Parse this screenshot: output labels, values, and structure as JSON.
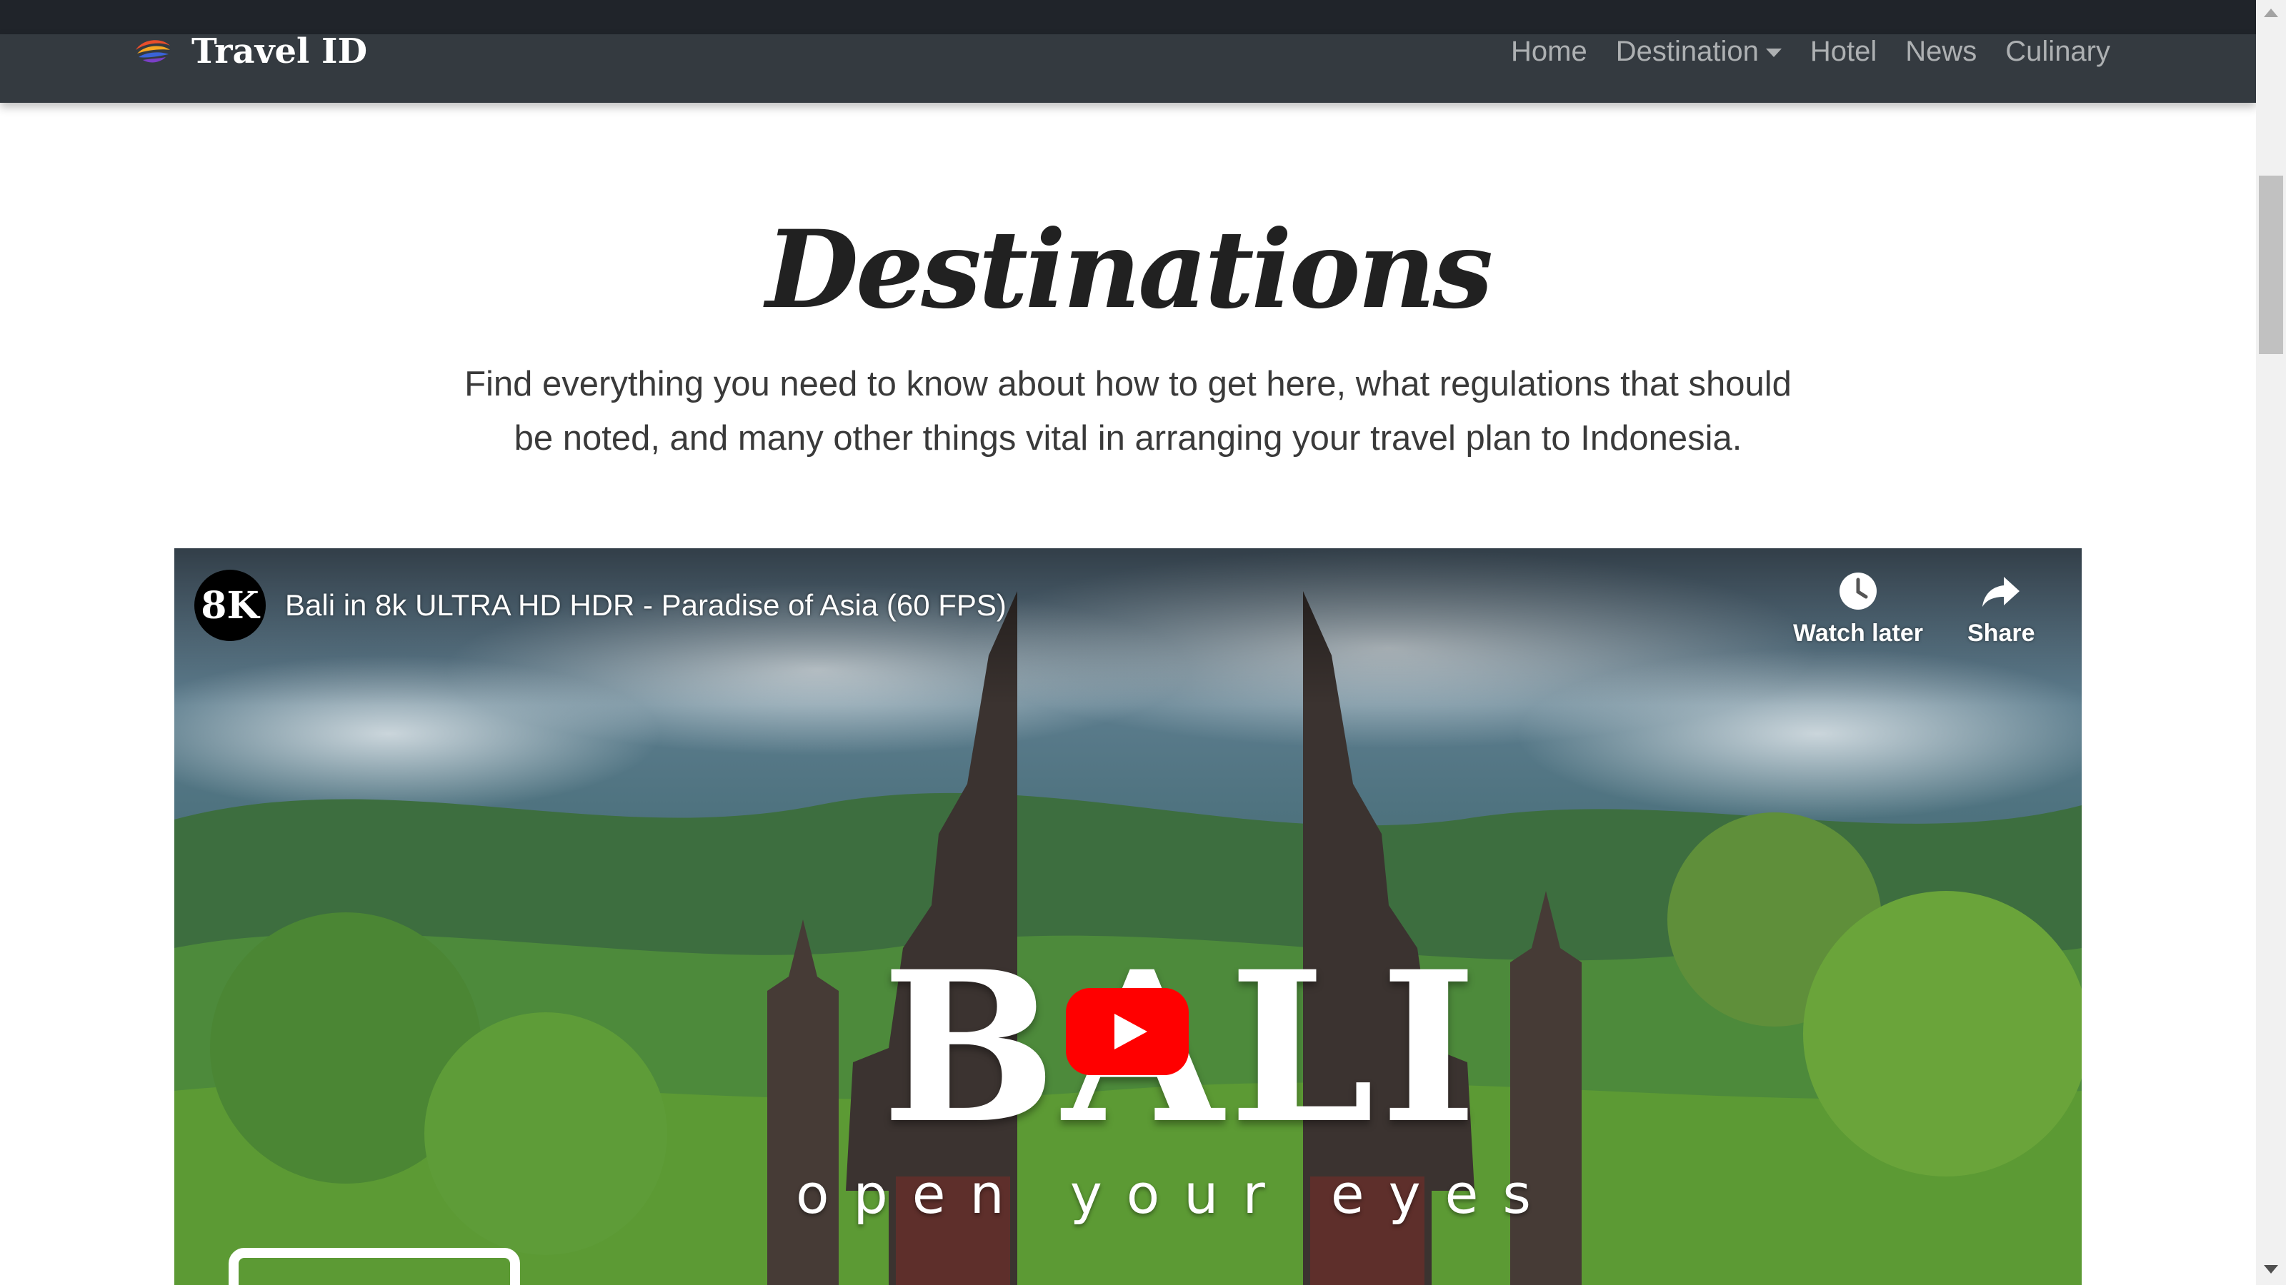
{
  "navbar": {
    "brand": "Travel ID",
    "links": {
      "home": "Home",
      "destination": "Destination",
      "hotel": "Hotel",
      "news": "News",
      "culinary": "Culinary"
    }
  },
  "hero": {
    "title": "Destinations",
    "lead": "Find everything you need to know about how to get here, what regulations that should be noted, and many other things vital in arranging your travel plan to Indonesia."
  },
  "video": {
    "channel_badge": "8K",
    "title": "Bali in 8k ULTRA HD HDR - Paradise of Asia (60 FPS)",
    "watch_later": "Watch later",
    "share": "Share",
    "overlay_word": "BALI",
    "overlay_tagline": "open your eyes"
  },
  "icons": [
    "travel-logo-icon",
    "caret-down-icon",
    "clock-icon",
    "share-arrow-icon",
    "youtube-play-icon"
  ],
  "colors": {
    "navbar": "#343a40",
    "play_red": "#ff0000"
  }
}
